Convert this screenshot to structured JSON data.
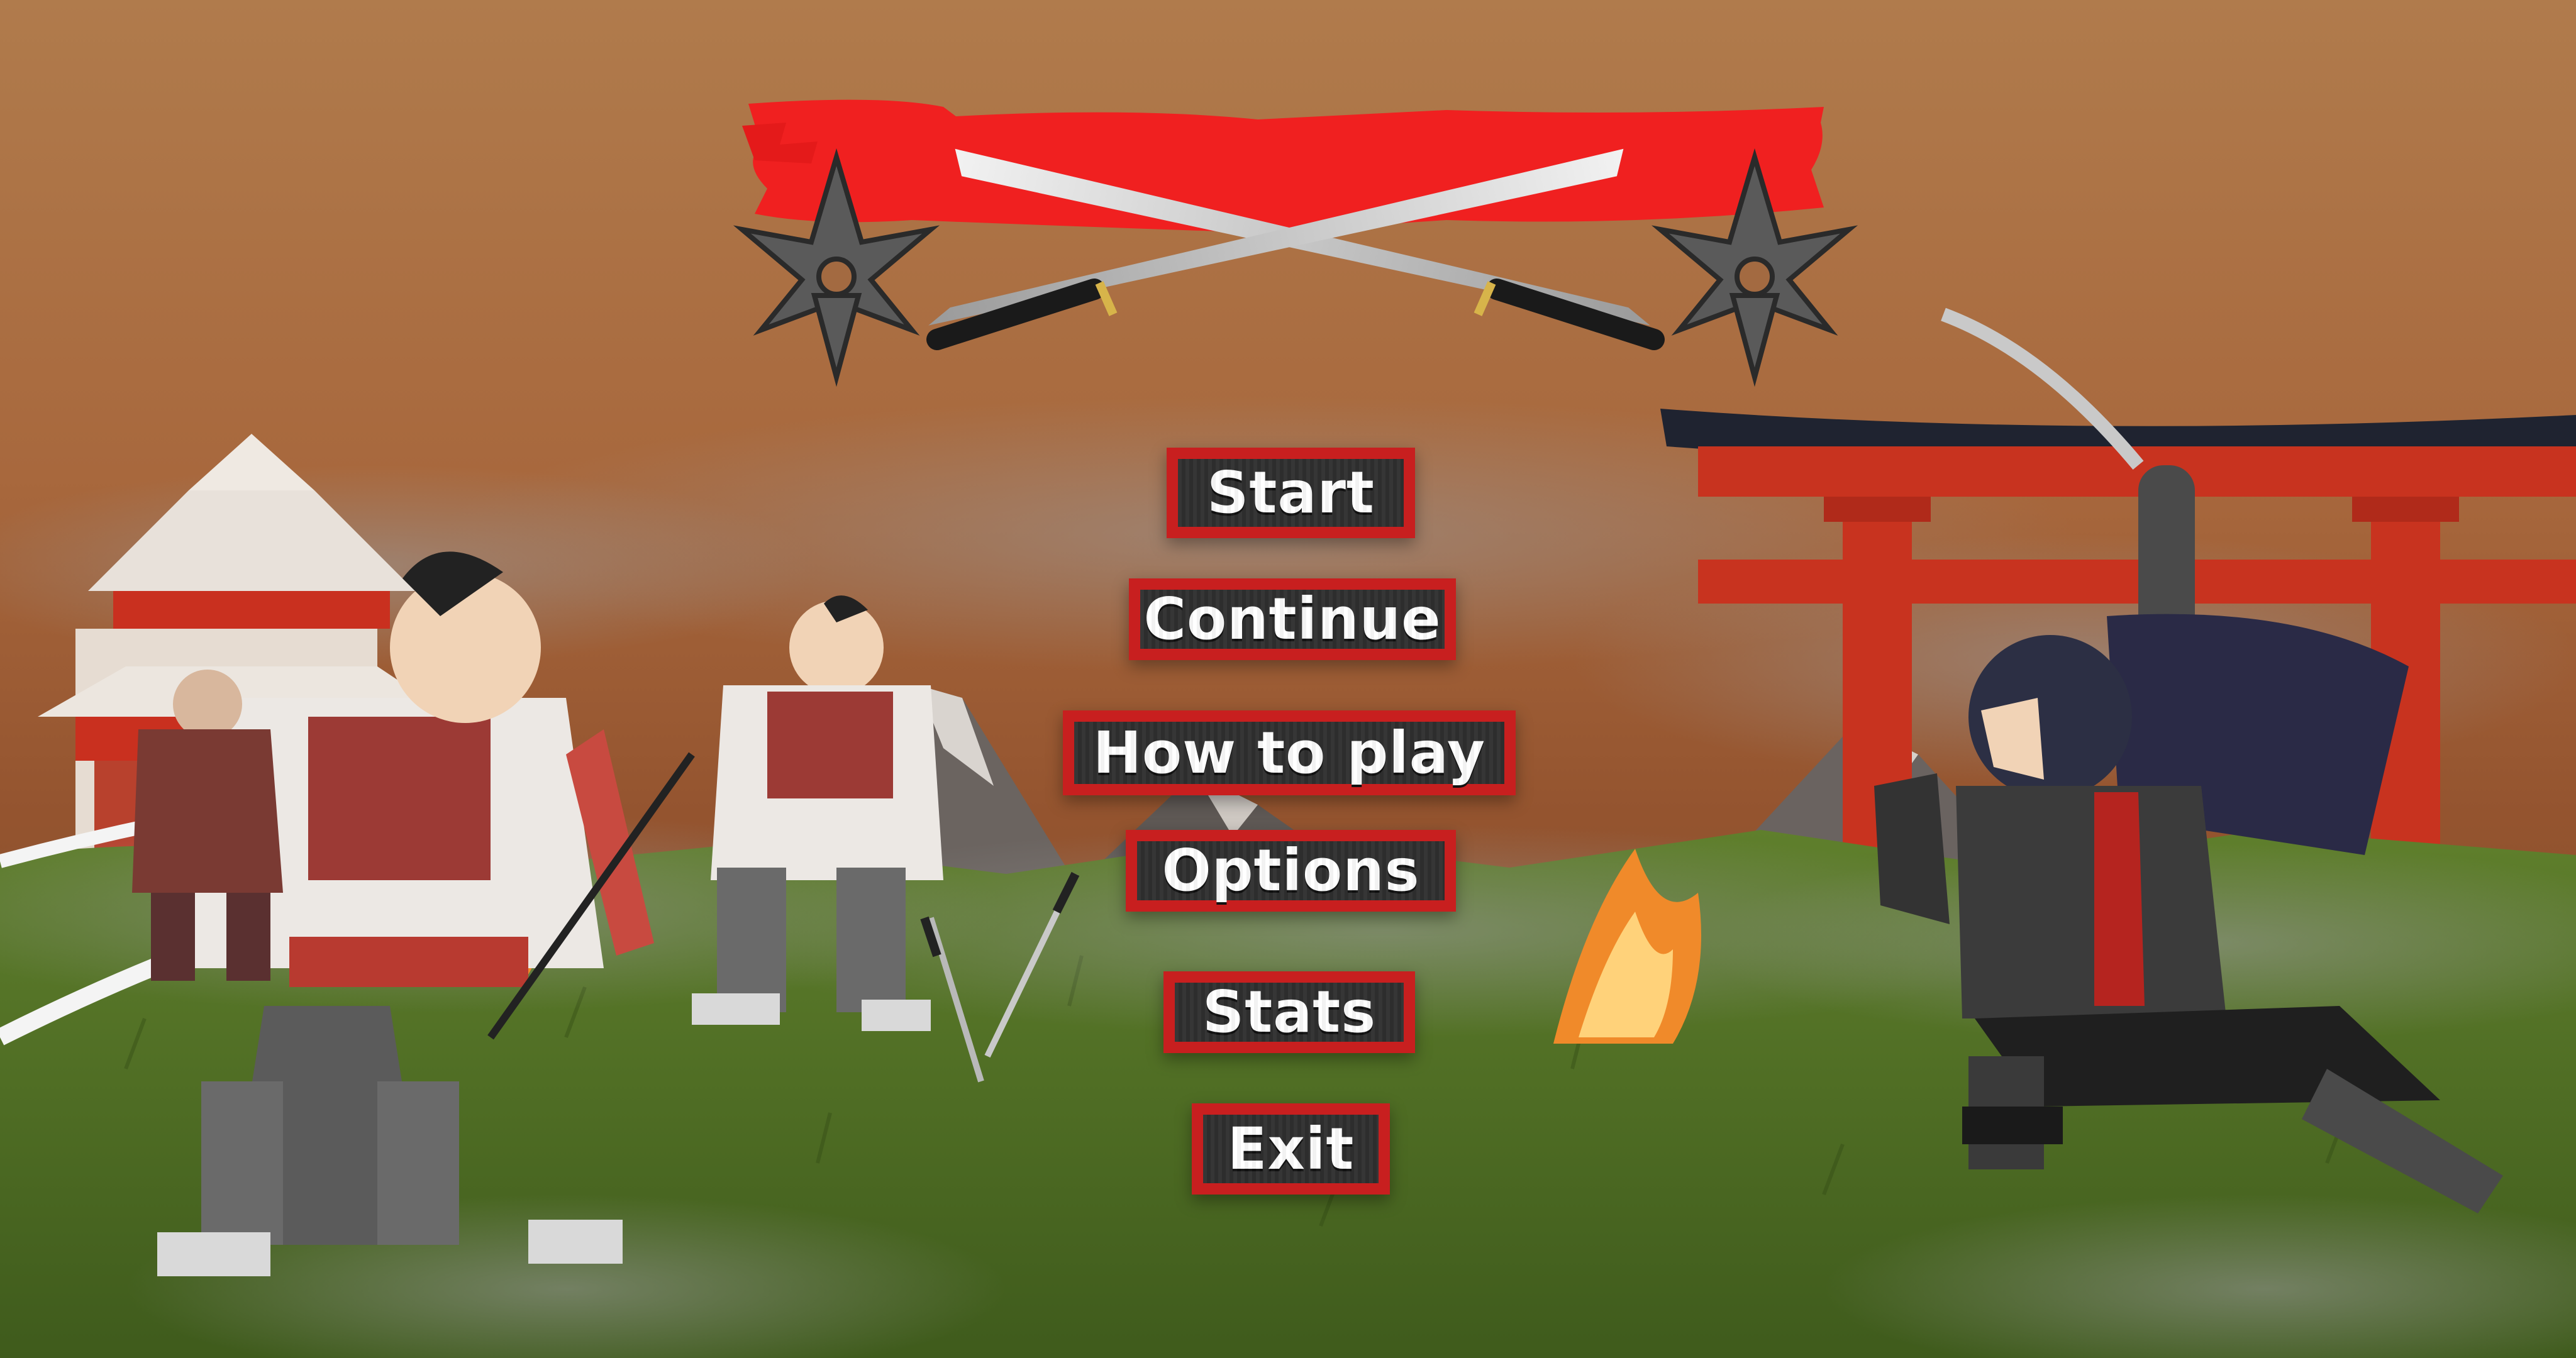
{
  "menu": {
    "start_label": "Start",
    "continue_label": "Continue",
    "how_to_play_label": "How to play",
    "options_label": "Options",
    "stats_label": "Stats",
    "exit_label": "Exit"
  },
  "colors": {
    "sky_top": "#b07a4b",
    "sky_mid": "#9b5a33",
    "banner_red": "#f02020",
    "button_fill": "#2f2f2f",
    "button_border": "#c81f1f",
    "grass": "#4d6f22",
    "torii_red": "#c8331f"
  },
  "icons": {
    "left_shuriken": "shuriken-icon",
    "right_shuriken": "shuriken-icon",
    "crossed_katanas": "katana-icon"
  }
}
